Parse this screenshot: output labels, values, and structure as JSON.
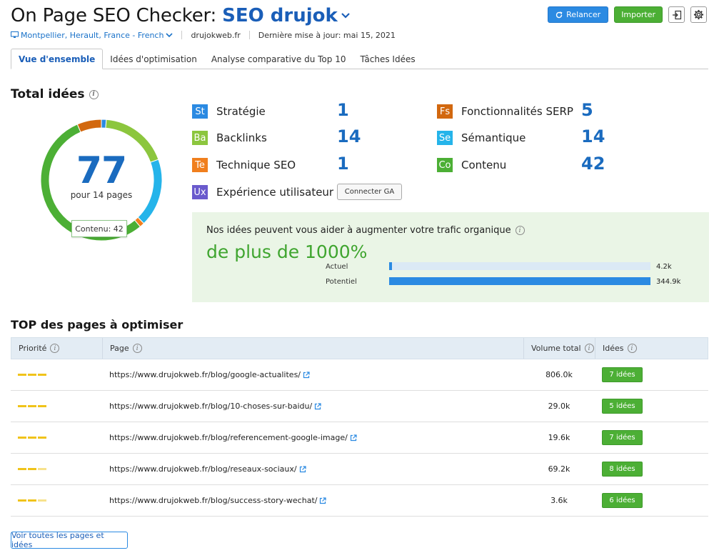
{
  "header": {
    "title": "On Page SEO Checker:",
    "project": "SEO drujok",
    "location": "Montpellier, Herault, France - French",
    "domain": "drujokweb.fr",
    "last_update": "Dernière mise à jour: mai 15, 2021",
    "relancer_label": "Relancer",
    "importer_label": "Importer"
  },
  "tabs": [
    {
      "label": "Vue d'ensemble"
    },
    {
      "label": "Idées d'optimisation"
    },
    {
      "label": "Analyse comparative du Top 10"
    },
    {
      "label": "Tâches Idées"
    }
  ],
  "total": {
    "title": "Total idées",
    "count": "77",
    "subtitle": "pour 14 pages",
    "tooltip": "Contenu: 42"
  },
  "categories": [
    {
      "badge": "St",
      "label": "Stratégie",
      "value": "1",
      "color": "#2b8ae2"
    },
    {
      "badge": "Ba",
      "label": "Backlinks",
      "value": "14",
      "color": "#8cc63e"
    },
    {
      "badge": "Te",
      "label": "Technique SEO",
      "value": "1",
      "color": "#f07f1e"
    },
    {
      "badge": "Ux",
      "label": "Expérience utilisateur",
      "value": "",
      "color": "#6a5acd"
    },
    {
      "badge": "Fs",
      "label": "Fonctionnalités SERP",
      "value": "5",
      "color": "#d2680f"
    },
    {
      "badge": "Se",
      "label": "Sémantique",
      "value": "14",
      "color": "#25b4ea"
    },
    {
      "badge": "Co",
      "label": "Contenu",
      "value": "42",
      "color": "#4caf35"
    }
  ],
  "connect_ga_label": "Connecter GA",
  "traffic": {
    "title": "Nos idées peuvent vous aider à augmenter votre trafic organique",
    "headline": "de plus de 1000%",
    "actuel_label": "Actuel",
    "actuel_value": "4.2k",
    "actuel_fraction": 0.012,
    "potentiel_label": "Potentiel",
    "potentiel_value": "344.9k",
    "potentiel_fraction": 1.0
  },
  "top_pages": {
    "title": "TOP des pages à optimiser",
    "columns": [
      "Priorité",
      "Page",
      "Volume total",
      "Idées"
    ],
    "rows": [
      {
        "url": "https://www.drujokweb.fr/blog/google-actualites/",
        "volume": "806.0k",
        "ideas": "7 idées",
        "priority": 3
      },
      {
        "url": "https://www.drujokweb.fr/blog/10-choses-sur-baidu/",
        "volume": "29.0k",
        "ideas": "5 idées",
        "priority": 3
      },
      {
        "url": "https://www.drujokweb.fr/blog/referencement-google-image/",
        "volume": "19.6k",
        "ideas": "7 idées",
        "priority": 3
      },
      {
        "url": "https://www.drujokweb.fr/blog/reseaux-sociaux/",
        "volume": "69.2k",
        "ideas": "8 idées",
        "priority": 2
      },
      {
        "url": "https://www.drujokweb.fr/blog/success-story-wechat/",
        "volume": "3.6k",
        "ideas": "6 idées",
        "priority": 2
      }
    ],
    "see_all_label": "Voir toutes les pages et idées"
  },
  "donut_segments": [
    {
      "name": "Stratégie",
      "value": 1,
      "color": "#2b8ae2"
    },
    {
      "name": "Backlinks",
      "value": 14,
      "color": "#8cc63e"
    },
    {
      "name": "Sémantique",
      "value": 14,
      "color": "#25b4ea"
    },
    {
      "name": "Technique SEO",
      "value": 1,
      "color": "#f07f1e"
    },
    {
      "name": "Contenu",
      "value": 42,
      "color": "#4caf35"
    },
    {
      "name": "Fonctionnalités SERP",
      "value": 5,
      "color": "#d2680f"
    }
  ]
}
